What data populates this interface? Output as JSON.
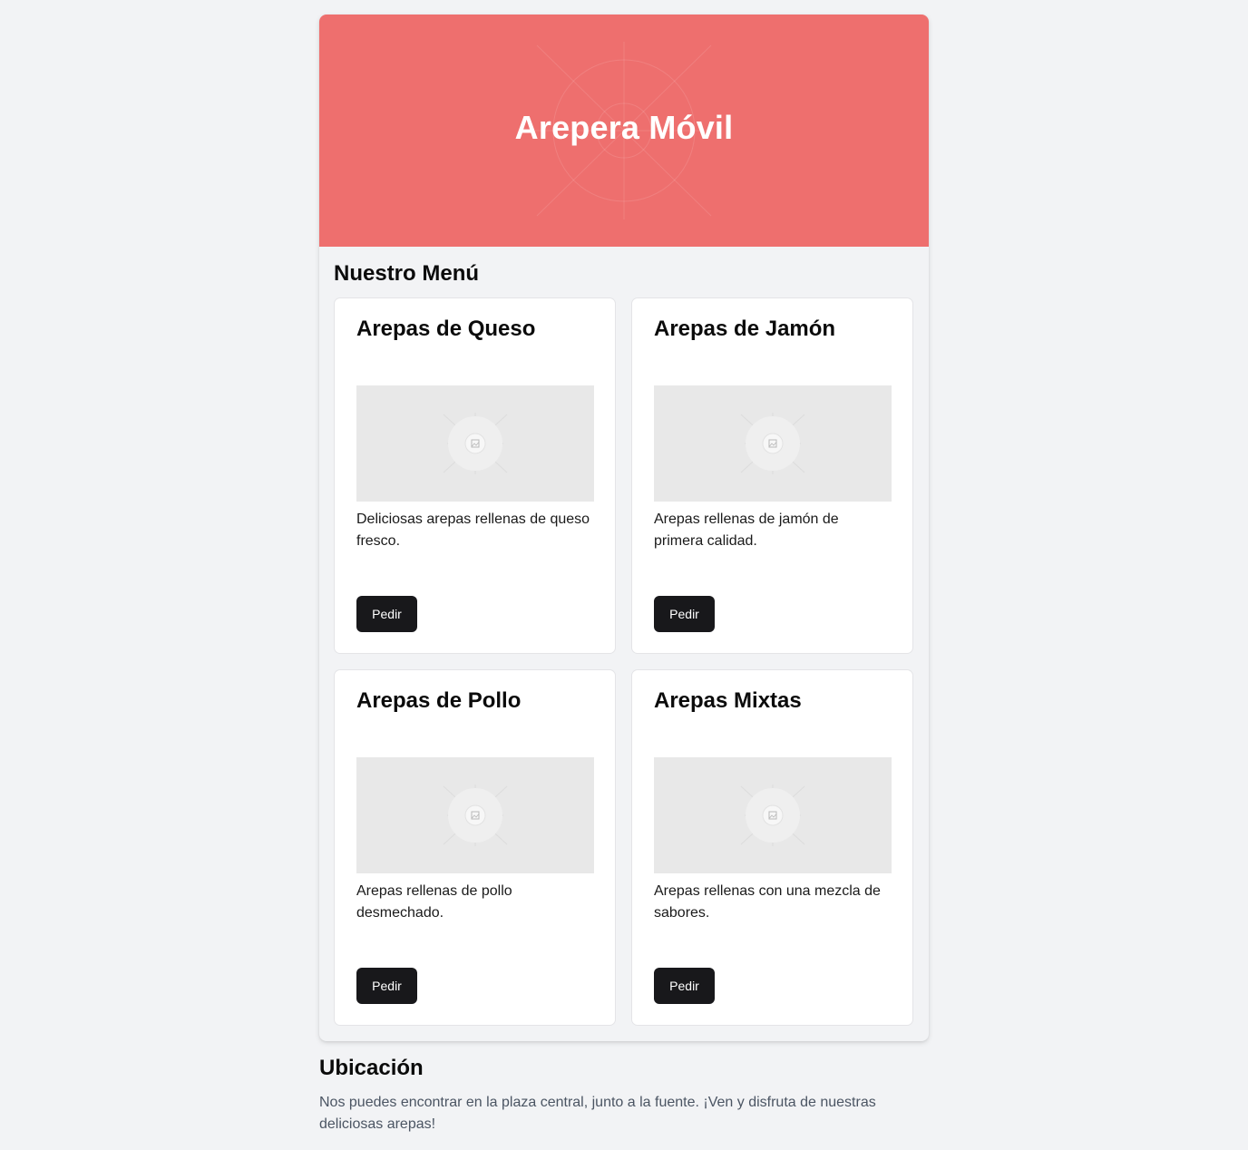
{
  "header": {
    "title": "Arepera Móvil",
    "background_color": "#ee6f6e"
  },
  "menu": {
    "title": "Nuestro Menú",
    "items": [
      {
        "name": "Arepas de Queso",
        "description": "Deliciosas arepas rellenas de queso fresco.",
        "image_icon": "image-placeholder-icon",
        "button_label": "Pedir"
      },
      {
        "name": "Arepas de Jamón",
        "description": "Arepas rellenas de jamón de primera calidad.",
        "image_icon": "image-placeholder-icon",
        "button_label": "Pedir"
      },
      {
        "name": "Arepas de Pollo",
        "description": "Arepas rellenas de pollo desmechado.",
        "image_icon": "image-placeholder-icon",
        "button_label": "Pedir"
      },
      {
        "name": "Arepas Mixtas",
        "description": "Arepas rellenas con una mezcla de sabores.",
        "image_icon": "image-placeholder-icon",
        "button_label": "Pedir"
      }
    ]
  },
  "location": {
    "title": "Ubicación",
    "text": "Nos puedes encontrar en la plaza central, junto a la fuente. ¡Ven y disfruta de nuestras deliciosas arepas!"
  },
  "colors": {
    "button": "#18181b",
    "page_background": "#f2f3f5"
  }
}
